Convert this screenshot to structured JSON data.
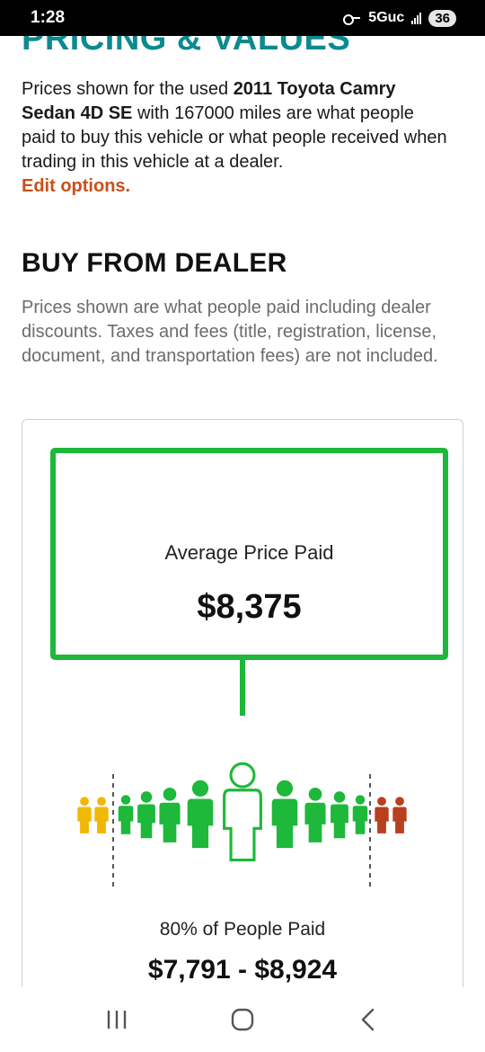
{
  "status_bar": {
    "time": "1:28",
    "network": "5Guc",
    "battery": "36",
    "icons": [
      "key-icon",
      "signal-icon"
    ]
  },
  "section": {
    "heading": "PRICING & VALUES"
  },
  "intro": {
    "text_before": "Prices shown for the used ",
    "vehicle": "2011 Toyota Camry Sedan 4D SE",
    "text_after": " with 167000 miles are what people paid to buy this vehicle or what people received when trading in this vehicle at a dealer.",
    "edit_link": "Edit options."
  },
  "buy_from_dealer": {
    "title": "BUY FROM DEALER",
    "description": "Prices shown are what people paid including dealer discounts. Taxes and fees (title, registration, license, document, and transportation fees) are not included."
  },
  "price_card": {
    "average_label": "Average Price Paid",
    "average_value": "$8,375",
    "range_label": "80% of People Paid",
    "range_value": "$7,791 - $8,924"
  },
  "colors": {
    "teal_heading": "#0b8a8f",
    "accent_link": "#c8501a",
    "green": "#1eb83a",
    "yellow": "#f2b705",
    "red": "#b8401e"
  },
  "nav_bar": {
    "icons": [
      "recent-apps-icon",
      "home-icon",
      "back-icon"
    ]
  }
}
